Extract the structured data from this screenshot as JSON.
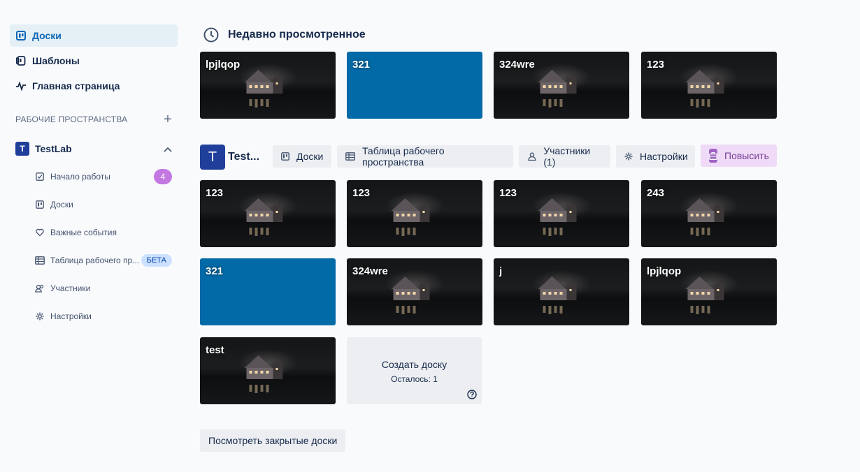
{
  "sidebar": {
    "nav": [
      {
        "label": "Доски",
        "icon": "boards-icon",
        "active": true
      },
      {
        "label": "Шаблоны",
        "icon": "templates-icon"
      },
      {
        "label": "Главная страница",
        "icon": "activity-icon"
      }
    ],
    "workspaces_header": "РАБОЧИЕ ПРОСТРАНСТВА",
    "workspace": {
      "initial": "T",
      "name": "TestLab"
    },
    "sub_items": [
      {
        "label": "Начало работы",
        "icon": "checkbox-icon",
        "badge": "4"
      },
      {
        "label": "Доски",
        "icon": "boards-icon"
      },
      {
        "label": "Важные события",
        "icon": "heart-icon"
      },
      {
        "label": "Таблица рабочего пр...",
        "icon": "table-icon",
        "badge_beta": "БЕТА"
      },
      {
        "label": "Участники",
        "icon": "members-icon"
      },
      {
        "label": "Настройки",
        "icon": "gear-icon"
      }
    ]
  },
  "recent": {
    "title": "Недавно просмотренное",
    "boards": [
      {
        "title": "lpjlqop",
        "bg": "photo"
      },
      {
        "title": "321",
        "bg": "blue"
      },
      {
        "title": "324wre",
        "bg": "photo"
      },
      {
        "title": "123",
        "bg": "photo"
      }
    ]
  },
  "workspace_bar": {
    "initial": "T",
    "name": "Test...",
    "buttons": {
      "boards": "Доски",
      "table": "Таблица рабочего пространства",
      "members": "Участники (1)",
      "settings": "Настройки",
      "upgrade": "Повысить"
    }
  },
  "workspace_boards": [
    {
      "title": "123",
      "bg": "photo"
    },
    {
      "title": "123",
      "bg": "photo"
    },
    {
      "title": "123",
      "bg": "photo"
    },
    {
      "title": "243",
      "bg": "photo"
    },
    {
      "title": "321",
      "bg": "blue"
    },
    {
      "title": "324wre",
      "bg": "photo"
    },
    {
      "title": "j",
      "bg": "photo"
    },
    {
      "title": "lpjlqop",
      "bg": "photo"
    },
    {
      "title": "test",
      "bg": "photo"
    }
  ],
  "create": {
    "label": "Создать доску",
    "remaining": "Осталось: 1"
  },
  "closed_boards": "Посмотреть закрытые доски",
  "colors": {
    "accent": "#0c66b4",
    "board_blue": "#026aa7",
    "workspace": "#203f9a",
    "badge": "#c377e0"
  }
}
